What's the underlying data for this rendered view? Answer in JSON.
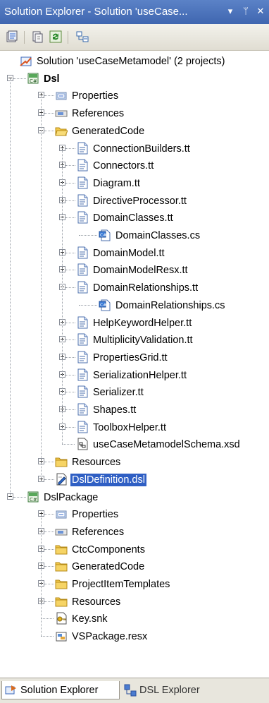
{
  "window": {
    "title": "Solution Explorer - Solution 'useCase...",
    "buttons": {
      "dropdown": "▾",
      "pin": "ᛘ",
      "close": "✕"
    }
  },
  "toolbar": {
    "buttons": [
      "properties-icon",
      "show-all-files-icon",
      "refresh-icon",
      "view-class-diagram-icon"
    ]
  },
  "tree": [
    {
      "id": "solution",
      "label": "Solution 'useCaseMetamodel' (2 projects)",
      "level": 0,
      "icon": "solution-icon",
      "expander": "none"
    },
    {
      "id": "dsl",
      "label": "Dsl",
      "level": 0,
      "icon": "csharp-project-icon",
      "expander": "minus",
      "bold": true
    },
    {
      "id": "dsl-properties",
      "label": "Properties",
      "level": 1,
      "icon": "properties-folder-icon",
      "expander": "plus"
    },
    {
      "id": "dsl-references",
      "label": "References",
      "level": 1,
      "icon": "references-icon",
      "expander": "plus"
    },
    {
      "id": "generatedcode",
      "label": "GeneratedCode",
      "level": 1,
      "icon": "folder-open-icon",
      "expander": "minus"
    },
    {
      "id": "connectionbuilders",
      "label": "ConnectionBuilders.tt",
      "level": 2,
      "icon": "tt-file-icon",
      "expander": "plus"
    },
    {
      "id": "connectors",
      "label": "Connectors.tt",
      "level": 2,
      "icon": "tt-file-icon",
      "expander": "plus"
    },
    {
      "id": "diagram",
      "label": "Diagram.tt",
      "level": 2,
      "icon": "tt-file-icon",
      "expander": "plus"
    },
    {
      "id": "directiveprocessor",
      "label": "DirectiveProcessor.tt",
      "level": 2,
      "icon": "tt-file-icon",
      "expander": "plus"
    },
    {
      "id": "domainclasses",
      "label": "DomainClasses.tt",
      "level": 2,
      "icon": "tt-file-icon",
      "expander": "minus"
    },
    {
      "id": "domainclasses-cs",
      "label": "DomainClasses.cs",
      "level": 3,
      "icon": "cs-file-icon",
      "expander": "none"
    },
    {
      "id": "domainmodel",
      "label": "DomainModel.tt",
      "level": 2,
      "icon": "tt-file-icon",
      "expander": "plus"
    },
    {
      "id": "domainmodelresx",
      "label": "DomainModelResx.tt",
      "level": 2,
      "icon": "tt-file-icon",
      "expander": "plus"
    },
    {
      "id": "domainrelationships",
      "label": "DomainRelationships.tt",
      "level": 2,
      "icon": "tt-file-icon",
      "expander": "minus"
    },
    {
      "id": "domainrelationships-cs",
      "label": "DomainRelationships.cs",
      "level": 3,
      "icon": "cs-file-icon",
      "expander": "none"
    },
    {
      "id": "helpkeywordhelper",
      "label": "HelpKeywordHelper.tt",
      "level": 2,
      "icon": "tt-file-icon",
      "expander": "plus"
    },
    {
      "id": "multiplicityvalidation",
      "label": "MultiplicityValidation.tt",
      "level": 2,
      "icon": "tt-file-icon",
      "expander": "plus"
    },
    {
      "id": "propertiesgrid",
      "label": "PropertiesGrid.tt",
      "level": 2,
      "icon": "tt-file-icon",
      "expander": "plus"
    },
    {
      "id": "serializationhelper",
      "label": "SerializationHelper.tt",
      "level": 2,
      "icon": "tt-file-icon",
      "expander": "plus"
    },
    {
      "id": "serializer",
      "label": "Serializer.tt",
      "level": 2,
      "icon": "tt-file-icon",
      "expander": "plus"
    },
    {
      "id": "shapes",
      "label": "Shapes.tt",
      "level": 2,
      "icon": "tt-file-icon",
      "expander": "plus"
    },
    {
      "id": "toolboxhelper",
      "label": "ToolboxHelper.tt",
      "level": 2,
      "icon": "tt-file-icon",
      "expander": "plus"
    },
    {
      "id": "schema",
      "label": "useCaseMetamodelSchema.xsd",
      "level": 2,
      "icon": "xsd-file-icon",
      "expander": "none"
    },
    {
      "id": "dsl-resources",
      "label": "Resources",
      "level": 1,
      "icon": "folder-icon",
      "expander": "plus"
    },
    {
      "id": "dsldefinition",
      "label": "DslDefinition.dsl",
      "level": 1,
      "icon": "dsl-file-icon",
      "expander": "plus",
      "selected": true
    },
    {
      "id": "dslpackage",
      "label": "DslPackage",
      "level": 0,
      "icon": "csharp-project-icon",
      "expander": "minus"
    },
    {
      "id": "pkg-properties",
      "label": "Properties",
      "level": 1,
      "icon": "properties-folder-icon",
      "expander": "plus"
    },
    {
      "id": "pkg-references",
      "label": "References",
      "level": 1,
      "icon": "references-icon",
      "expander": "plus"
    },
    {
      "id": "ctccomponents",
      "label": "CtcComponents",
      "level": 1,
      "icon": "folder-icon",
      "expander": "plus"
    },
    {
      "id": "pkg-generatedcode",
      "label": "GeneratedCode",
      "level": 1,
      "icon": "folder-icon",
      "expander": "plus"
    },
    {
      "id": "projectitemtemplates",
      "label": "ProjectItemTemplates",
      "level": 1,
      "icon": "folder-icon",
      "expander": "plus"
    },
    {
      "id": "pkg-resources",
      "label": "Resources",
      "level": 1,
      "icon": "folder-icon",
      "expander": "plus"
    },
    {
      "id": "keysnk",
      "label": "Key.snk",
      "level": 1,
      "icon": "key-file-icon",
      "expander": "none"
    },
    {
      "id": "vspackage",
      "label": "VSPackage.resx",
      "level": 1,
      "icon": "resx-file-icon",
      "expander": "none"
    }
  ],
  "tabs": [
    {
      "id": "solution-explorer",
      "label": "Solution Explorer",
      "icon": "solution-explorer-icon",
      "active": true
    },
    {
      "id": "dsl-explorer",
      "label": "DSL Explorer",
      "icon": "dsl-explorer-icon",
      "active": false
    }
  ],
  "colors": {
    "selection": "#2f5fc4",
    "title_bar": "#4a72ba",
    "folder": "#f2c84b"
  }
}
